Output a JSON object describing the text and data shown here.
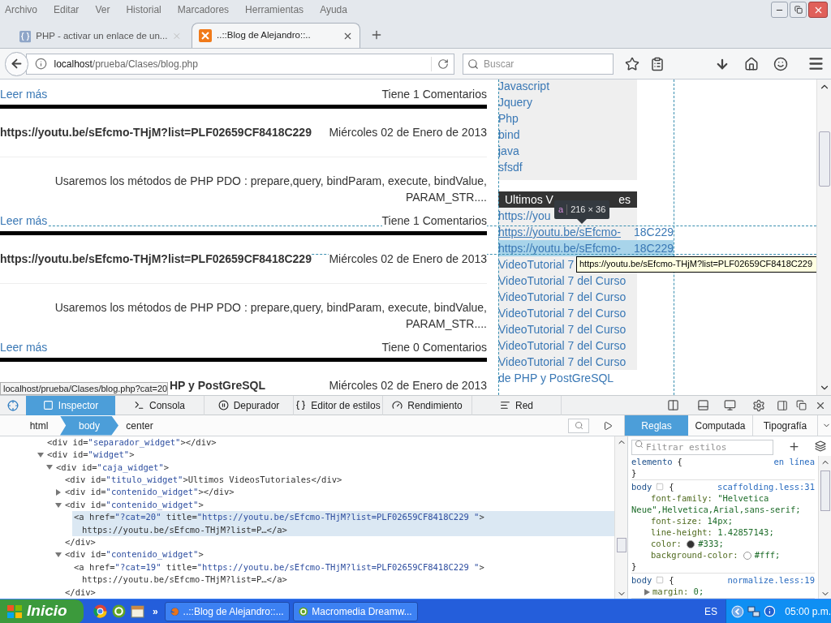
{
  "menu": [
    "Archivo",
    "Editar",
    "Ver",
    "Historial",
    "Marcadores",
    "Herramientas",
    "Ayuda"
  ],
  "tabs": [
    {
      "title": "PHP - activar un enlace de un...",
      "selected": false
    },
    {
      "title": "..::Blog de Alejandro::..",
      "selected": true
    }
  ],
  "address": {
    "host": "localhost",
    "path": "/prueba/Clases/blog.php"
  },
  "search": {
    "placeholder": "Buscar"
  },
  "page": {
    "posts": [
      {
        "read_more": "Leer más",
        "comments": "Tiene 1 Comentarios"
      },
      {
        "title": "https://youtu.be/sEfcmo-THjM?list=PLF02659CF8418C229",
        "covered": false,
        "date": "Miércoles 02 de Enero de 2013",
        "excerpt": "Usaremos los métodos de PHP PDO : prepare,query, bindParam, execute, bindValue, PARAM_STR....",
        "read_more": "Leer más",
        "comments": "Tiene 1 Comentarios"
      },
      {
        "title": "https://youtu.be/sEfcmo-THjM?list=PLF02659CF8418C229",
        "covered": false,
        "date": "Miércoles 02 de Enero de 2013",
        "excerpt": "Usaremos los métodos de PHP PDO : prepare,query, bindParam, execute, bindValue, PARAM_STR....",
        "read_more": "Leer más",
        "comments": "Tiene 0 Comentarios"
      },
      {
        "title": "HP y PostGreSQL",
        "covered": true,
        "date": "Miércoles 02 de Enero de 2013"
      }
    ],
    "status_link": "localhost/prueba/Clases/blog.php?cat=20",
    "categories": [
      "Javascript",
      "Jquery",
      "Php",
      "bind",
      "java",
      "sfsdf"
    ],
    "widget_title_start": "Ultimos V",
    "widget_title_end": "es",
    "video_links": [
      {
        "text": "https://you",
        "hovered": false,
        "highlighted": false,
        "shaded": true
      },
      {
        "text": "https://youtu.be/sEfcmo-",
        "tail": "18C229",
        "hovered": true,
        "highlighted": false,
        "shaded": true
      },
      {
        "text": "https://youtu.be/sEfcmo-",
        "tail": "18C229",
        "hovered": false,
        "highlighted": true,
        "shaded": true
      },
      {
        "text": "VideoTutorial 7",
        "hovered": false,
        "highlighted": false,
        "shaded": true
      },
      {
        "text": "VideoTutorial 7 del Curso",
        "hovered": false,
        "highlighted": false,
        "shaded": true
      },
      {
        "text": "VideoTutorial 7 del Curso",
        "hovered": false,
        "highlighted": false,
        "shaded": true
      },
      {
        "text": "VideoTutorial 7 del Curso",
        "hovered": false,
        "highlighted": false,
        "shaded": true
      },
      {
        "text": "VideoTutorial 7 del Curso",
        "hovered": false,
        "highlighted": false,
        "shaded": true
      },
      {
        "text": "VideoTutorial 7 del Curso",
        "hovered": false,
        "highlighted": false,
        "shaded": true
      },
      {
        "text": "VideoTutorial 7 del Curso",
        "hovered": false,
        "highlighted": false,
        "shaded": true
      },
      {
        "text": "de PHP y PostGreSQL",
        "hovered": false,
        "highlighted": false,
        "shaded": false
      }
    ],
    "node_tip": {
      "tag": "a",
      "size": "216 × 36"
    },
    "title_tip": "https://youtu.be/sEfcmo-THjM?list=PLF02659CF8418C229"
  },
  "devtools": {
    "tools": [
      {
        "label": "Inspector",
        "selected": true
      },
      {
        "label": "Consola",
        "selected": false
      },
      {
        "label": "Depurador",
        "selected": false
      },
      {
        "label": "Editor de estilos",
        "selected": false
      },
      {
        "label": "Rendimiento",
        "selected": false
      },
      {
        "label": "Red",
        "selected": false
      }
    ],
    "breadcrumbs": [
      {
        "label": "html",
        "selected": false
      },
      {
        "label": "body",
        "selected": true
      },
      {
        "label": "center",
        "selected": false
      }
    ],
    "side_tabs": [
      {
        "label": "Reglas",
        "selected": true
      },
      {
        "label": "Computada",
        "selected": false
      },
      {
        "label": "Tipografía",
        "selected": false
      }
    ],
    "filter": {
      "placeholder": "Filtrar estilos"
    },
    "markup": [
      {
        "lines": [
          "<div id=\"separador_widget\"></div>"
        ],
        "selected": false
      },
      {
        "lines": [
          "<div id=\"widget\">"
        ],
        "expanded": true,
        "selected": false,
        "children": [
          {
            "lines": [
              "<div id=\"caja_widget\">"
            ],
            "expanded": true,
            "selected": false,
            "children": [
              {
                "lines": [
                  "<div id=\"titulo_widget\">Ultimos VideosTutoriales</div>"
                ],
                "selected": false
              },
              {
                "lines": [
                  "<div id=\"contenido_widget\"></div>"
                ],
                "expanded": false,
                "selected": false
              },
              {
                "lines": [
                  "<div id=\"contenido_widget\">"
                ],
                "expanded": true,
                "selected": false,
                "close": "</div>",
                "children": [
                  {
                    "lines": [
                      "<a href=\"?cat=20\" title=\"https://youtu.be/sEfcmo-THjM?list=PLF02659CF8418C229 \">",
                      "https://youtu.be/sEfcmo-THjM?list=P…</a>"
                    ],
                    "selected": true
                  }
                ]
              },
              {
                "lines": [
                  "<div id=\"contenido_widget\">"
                ],
                "expanded": true,
                "selected": false,
                "close": "</div>",
                "children": [
                  {
                    "lines": [
                      "<a href=\"?cat=19\" title=\"https://youtu.be/sEfcmo-THjM?list=PLF02659CF8418C229 \">",
                      "https://youtu.be/sEfcmo-THjM?list=P…</a>"
                    ],
                    "selected": false
                  }
                ]
              }
            ]
          }
        ]
      }
    ],
    "rules": [
      {
        "kind": "inline",
        "selector": "elemento",
        "brace_open": "{",
        "source": "en línea",
        "brace_close": "}"
      },
      {
        "kind": "sheet",
        "selector": "body",
        "brace_open": "{",
        "source": "scaffolding.less:31",
        "brace_close": "}",
        "declarations": [
          {
            "kind": "plain",
            "prop": "font-family:",
            "value": "\"Helvetica Neue\",Helvetica,Arial,sans-serif;"
          },
          {
            "kind": "plain",
            "prop": "font-size:",
            "value": "14px;"
          },
          {
            "kind": "plain",
            "prop": "line-height:",
            "value": "1.42857143;"
          },
          {
            "kind": "plain",
            "prop": "color:",
            "value": "#333;",
            "color": "#333333"
          },
          {
            "kind": "plain",
            "prop": "background-color:",
            "value": "#fff;",
            "color": "#ffffff"
          }
        ]
      },
      {
        "kind": "sheet",
        "selector": "body",
        "brace_open": "{",
        "source": "normalize.less:19",
        "declarations": [
          {
            "kind": "shorthand",
            "prop": "margin:",
            "value": "0;"
          }
        ]
      }
    ]
  },
  "taskbar": {
    "start": "Inicio",
    "more": "»",
    "tasks": [
      {
        "label": "..::Blog de Alejandro::...",
        "kind": "browser"
      },
      {
        "label": "Macromedia Dreamw...",
        "kind": "editor"
      }
    ],
    "language": "ES",
    "time": "05:00 p.m."
  }
}
